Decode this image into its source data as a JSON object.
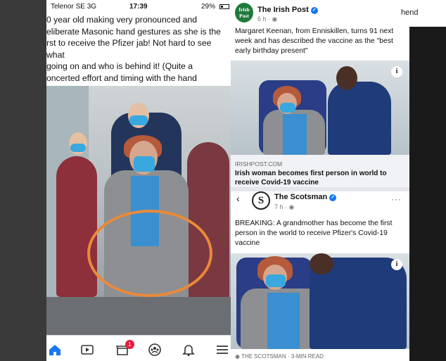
{
  "overlay": {
    "top_right_label": "hend"
  },
  "status_bar": {
    "carrier": "Telenor SE  3G",
    "time": "17:39",
    "battery": "29%"
  },
  "post": {
    "text": "0 year old making very pronounced and\neliberate Masonic hand gestures as she is the\nrst to receive the Pfizer jab! Not hard to see what\n going on and who is behind it! (Quite a\noncerted effort and timing with the hand\nymbolism too when you watch the news video)."
  },
  "tab_bar": {
    "items": [
      {
        "icon": "home-icon",
        "active": true
      },
      {
        "icon": "video-icon"
      },
      {
        "icon": "marketplace-icon",
        "badge": "1"
      },
      {
        "icon": "groups-icon"
      },
      {
        "icon": "bell-icon"
      },
      {
        "icon": "menu-icon"
      }
    ],
    "accent": "#1877f2"
  },
  "irish_post": {
    "logo": "Irish Post",
    "page_name": "The Irish Post",
    "meta": "6 h · ",
    "text": "Margaret Keenan, from Enniskillen, turns 91 next week and has described the vaccine as the \"best early birthday present\"",
    "link_domain": "IRISHPOST.COM",
    "link_title": "Irish woman becomes first person in world to receive Covid-19 vaccine"
  },
  "scotsman": {
    "back": "‹",
    "logo": "S",
    "page_name": "The Scotsman",
    "meta": "7 h · ",
    "more": "···",
    "text": "BREAKING: A grandmother has become the first person in the world to receive Pfizer's Covid-19 vaccine",
    "footer": "THE SCOTSMAN · 3-MIN READ"
  },
  "annotation_color": "#e98a3a"
}
